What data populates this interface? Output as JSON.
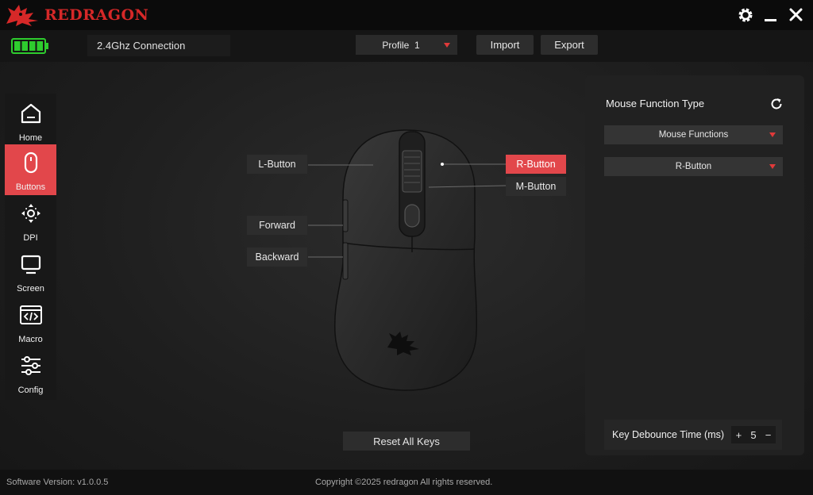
{
  "app": {
    "brand": "REDRAGON"
  },
  "window": {
    "settings_icon": "gear-icon",
    "minimize_icon": "minimize-icon",
    "close_icon": "close-icon"
  },
  "status": {
    "battery_level": 1.0,
    "connection": "2.4Ghz Connection"
  },
  "toolbar": {
    "profile": "Profile  1",
    "import_label": "Import",
    "export_label": "Export"
  },
  "sidebar": {
    "items": [
      {
        "label": "Home",
        "icon": "home-icon",
        "active": false
      },
      {
        "label": "Buttons",
        "icon": "mouse-icon",
        "active": true
      },
      {
        "label": "DPI",
        "icon": "dpi-icon",
        "active": false
      },
      {
        "label": "Screen",
        "icon": "monitor-icon",
        "active": false
      },
      {
        "label": "Macro",
        "icon": "code-icon",
        "active": false
      },
      {
        "label": "Config",
        "icon": "sliders-icon",
        "active": false
      }
    ]
  },
  "buttons": {
    "l_button": "L-Button",
    "forward": "Forward",
    "backward": "Backward",
    "r_button": "R-Button",
    "m_button": "M-Button",
    "selected": "R-Button",
    "reset_label": "Reset All Keys"
  },
  "panel": {
    "title": "Mouse Function Type",
    "type_select": "Mouse Functions",
    "function_select": "R-Button",
    "debounce_label": "Key Debounce Time (ms)",
    "debounce_value": "5",
    "plus": "+",
    "minus": "−"
  },
  "colors": {
    "accent": "#e2474b",
    "battery": "#2ecc2e"
  },
  "footer": {
    "version": "Software Version: v1.0.0.5",
    "copyright": "Copyright ©2025 redragon All rights reserved."
  }
}
